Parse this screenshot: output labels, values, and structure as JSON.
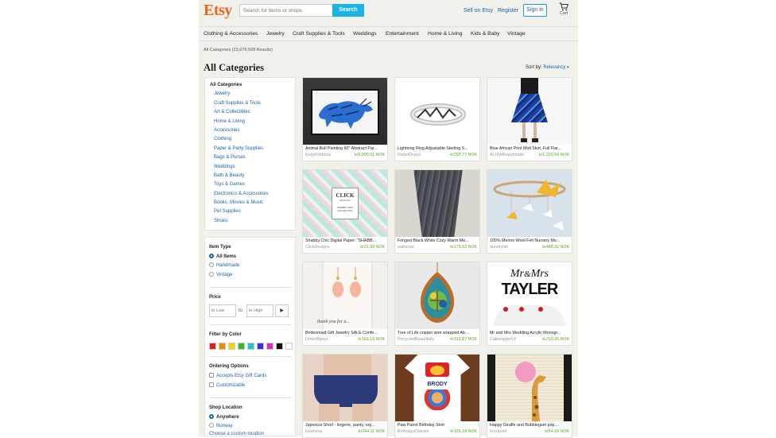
{
  "header": {
    "logo": "Etsy",
    "search_placeholder": "Search for items or shops",
    "search_button": "Search",
    "sell_link": "Sell on Etsy",
    "register_link": "Register",
    "signin_button": "Sign in",
    "cart_label": "Cart"
  },
  "nav": [
    "Clothing & Accessories",
    "Jewelry",
    "Craft Supplies & Tools",
    "Weddings",
    "Entertainment",
    "Home & Living",
    "Kids & Baby",
    "Vintage"
  ],
  "breadcrumb": "All Categories (23,676,508 Results)",
  "page_title": "All Categories",
  "sort": {
    "label": "Sort by:",
    "value": "Relevancy"
  },
  "categories": {
    "heading": "All Categories",
    "items": [
      "Jewelry",
      "Craft Supplies & Tools",
      "Art & Collectibles",
      "Home & Living",
      "Accessories",
      "Clothing",
      "Paper & Party Supplies",
      "Bags & Purses",
      "Weddings",
      "Bath & Beauty",
      "Toys & Games",
      "Electronics & Accessories",
      "Books, Movies & Music",
      "Pet Supplies",
      "Shoes"
    ]
  },
  "filters": {
    "item_type": {
      "heading": "Item Type",
      "options": [
        "All Items",
        "Handmade",
        "Vintage"
      ],
      "selected": "All Items"
    },
    "price": {
      "heading": "Price",
      "low_placeholder": "kr Low",
      "to": "to",
      "high_placeholder": "kr High",
      "go": "▶"
    },
    "color": {
      "heading": "Filter by Color",
      "swatches": [
        "#e02020",
        "#f08a00",
        "#f2d800",
        "#37b531",
        "#1fc7d4",
        "#3a2ee0",
        "#d631c9",
        "#111111",
        "#ffffff"
      ]
    },
    "ordering": {
      "heading": "Ordering Options",
      "options": [
        "Accepts Etsy Gift Cards",
        "Customizable"
      ]
    },
    "shop_location": {
      "heading": "Shop Location",
      "options": [
        "Anywhere",
        "Norway",
        "Choose a custom location"
      ],
      "selected": "Anywhere"
    }
  },
  "listings": [
    {
      "title": "Animal Bull Painting 60\" Abstract Pai...",
      "shop": "KobyFeldmos",
      "price": "kr5,000.51 NOK"
    },
    {
      "title": "Lightning Ring Adjustable Sterling S...",
      "shop": "RebelOcean",
      "price": "kr293.77 NOK"
    },
    {
      "title": "Blue African Print Midi Skirt, Full Flar...",
      "shop": "ALUMAhandmade",
      "price": "kr1,220.54 NOK"
    },
    {
      "title": "Shabby Chic Digital Paper: \"SHABB...",
      "shop": "ClickDesigns",
      "price": "kr31.99 NOK"
    },
    {
      "title": "Fringed Black White Cozy Warm Me...",
      "shop": "eatherpe",
      "price": "kr175.53 NOK"
    },
    {
      "title": "100% Merino Wool Felt Nursery Mo...",
      "shop": "dundryhill",
      "price": "kr488.32 NOK"
    },
    {
      "title": "Bridesmaid Gift Jewelry SALE Confe...",
      "shop": "LimonBijoux",
      "price": "kr169.19 NOK"
    },
    {
      "title": "Tree of Life copper wire wrapped Ab...",
      "shop": "RecycledBeautifully",
      "price": "kr319.87 NOK"
    },
    {
      "title": "Mr and Mrs Wedding Acrylic Monogr...",
      "shop": "CaketopperLF",
      "price": "kr210.35 NOK"
    },
    {
      "title": "Japonica Short - lingerie, panty, org...",
      "shop": "luvahuva",
      "price": "kr244.11 NOK"
    },
    {
      "title": "Paw Patrol Birthday Shirt",
      "shop": "BirthdaysDaisies",
      "price": "kr126.18 NOK"
    },
    {
      "title": "Happy Giraffe and Bubblegum pop....",
      "shop": "fessiprint",
      "price": "kr64.18 NOK"
    }
  ],
  "image_text": {
    "click_designs": [
      "CLICK",
      "DESIGNS",
      "SHABBY CHIC",
      "COLLECTION"
    ],
    "earrings_card": "thank you for a...",
    "paw_patrol": "BRODY",
    "cake_topper": [
      "Mr",
      "&",
      "Mrs",
      "TAYLER"
    ]
  }
}
